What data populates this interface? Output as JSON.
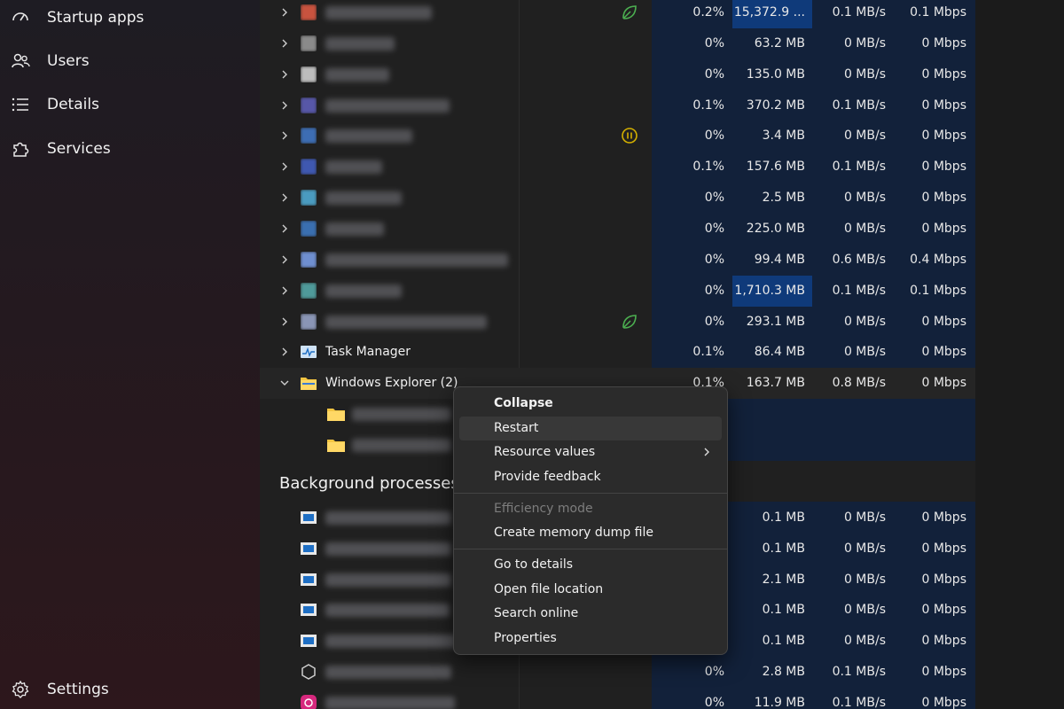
{
  "sidebar": {
    "items": [
      {
        "label": "Startup apps",
        "icon": "gauge-icon"
      },
      {
        "label": "Users",
        "icon": "users-icon"
      },
      {
        "label": "Details",
        "icon": "list-icon"
      },
      {
        "label": "Services",
        "icon": "puzzle-icon"
      }
    ],
    "settings_label": "Settings"
  },
  "colors": {
    "accent_highlight": "#0f3a7a",
    "column_tint": "#12213a",
    "efficiency_leaf": "#4caf50",
    "paused": "#d4b000"
  },
  "processes": [
    {
      "name": "",
      "icon": "app-icon",
      "status": "efficiency-leaf-icon",
      "cpu": "0.2%",
      "memory": "15,372.9 ...",
      "disk": "0.1 MB/s",
      "network": "0.1 Mbps",
      "mem_highlight": true
    },
    {
      "name": "",
      "icon": "app-icon",
      "status": "",
      "cpu": "0%",
      "memory": "63.2 MB",
      "disk": "0 MB/s",
      "network": "0 Mbps"
    },
    {
      "name": "",
      "icon": "app-icon",
      "status": "",
      "cpu": "0%",
      "memory": "135.0 MB",
      "disk": "0 MB/s",
      "network": "0 Mbps"
    },
    {
      "name": "",
      "icon": "app-icon",
      "status": "",
      "cpu": "0.1%",
      "memory": "370.2 MB",
      "disk": "0.1 MB/s",
      "network": "0 Mbps"
    },
    {
      "name": "",
      "icon": "app-icon",
      "status": "paused-icon",
      "cpu": "0%",
      "memory": "3.4 MB",
      "disk": "0 MB/s",
      "network": "0 Mbps"
    },
    {
      "name": "",
      "icon": "app-icon",
      "status": "",
      "cpu": "0.1%",
      "memory": "157.6 MB",
      "disk": "0.1 MB/s",
      "network": "0 Mbps"
    },
    {
      "name": "",
      "icon": "app-icon",
      "status": "",
      "cpu": "0%",
      "memory": "2.5 MB",
      "disk": "0 MB/s",
      "network": "0 Mbps"
    },
    {
      "name": "",
      "icon": "app-icon",
      "status": "",
      "cpu": "0%",
      "memory": "225.0 MB",
      "disk": "0 MB/s",
      "network": "0 Mbps"
    },
    {
      "name": "",
      "icon": "app-icon",
      "status": "",
      "cpu": "0%",
      "memory": "99.4 MB",
      "disk": "0.6 MB/s",
      "network": "0.4 Mbps"
    },
    {
      "name": "",
      "icon": "app-icon",
      "status": "",
      "cpu": "0%",
      "memory": "1,710.3 MB",
      "disk": "0.1 MB/s",
      "network": "0.1 Mbps",
      "mem_highlight": true
    },
    {
      "name": "",
      "icon": "app-icon",
      "status": "efficiency-leaf-icon",
      "cpu": "0%",
      "memory": "293.1 MB",
      "disk": "0 MB/s",
      "network": "0 Mbps"
    },
    {
      "name": "Task Manager",
      "icon": "task-manager-icon",
      "status": "",
      "cpu": "0.1%",
      "memory": "86.4 MB",
      "disk": "0 MB/s",
      "network": "0 Mbps"
    },
    {
      "name": "Windows Explorer (2)",
      "icon": "folder-icon",
      "status": "",
      "cpu": "0.1%",
      "memory": "163.7 MB",
      "disk": "0.8 MB/s",
      "network": "0 Mbps",
      "expanded": true
    }
  ],
  "background_header": "Background processes",
  "background_processes": [
    {
      "memory": "0.1 MB",
      "disk": "0 MB/s",
      "network": "0 Mbps",
      "cpu": ""
    },
    {
      "memory": "0.1 MB",
      "disk": "0 MB/s",
      "network": "0 Mbps",
      "cpu": ""
    },
    {
      "memory": "2.1 MB",
      "disk": "0 MB/s",
      "network": "0 Mbps",
      "cpu": ""
    },
    {
      "memory": "0.1 MB",
      "disk": "0 MB/s",
      "network": "0 Mbps",
      "cpu": ""
    },
    {
      "memory": "0.1 MB",
      "disk": "0 MB/s",
      "network": "0 Mbps",
      "cpu": ""
    },
    {
      "memory": "2.8 MB",
      "disk": "0.1 MB/s",
      "network": "0 Mbps",
      "cpu": "0%"
    },
    {
      "memory": "11.9 MB",
      "disk": "0.1 MB/s",
      "network": "0 Mbps",
      "cpu": "0%"
    }
  ],
  "context_menu": {
    "collapse": "Collapse",
    "restart": "Restart",
    "resource_values": "Resource values",
    "provide_feedback": "Provide feedback",
    "efficiency_mode": "Efficiency mode",
    "create_dump": "Create memory dump file",
    "go_to_details": "Go to details",
    "open_file_location": "Open file location",
    "search_online": "Search online",
    "properties": "Properties"
  }
}
